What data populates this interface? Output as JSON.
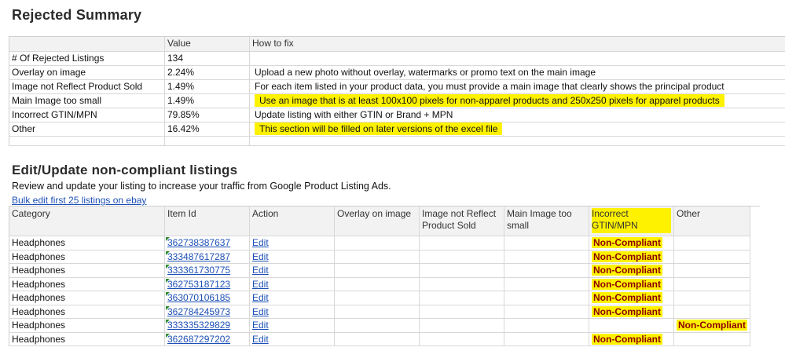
{
  "summary": {
    "title": "Rejected Summary",
    "headers": {
      "label": "",
      "value": "Value",
      "fix": "How to fix"
    },
    "rows": [
      {
        "label": "# Of Rejected Listings",
        "value": "134",
        "fix": ""
      },
      {
        "label": "Overlay on image",
        "value": "2.24%",
        "fix": "Upload a new photo without overlay, watermarks or promo text on the main image"
      },
      {
        "label": "Image not Reflect Product Sold",
        "value": "1.49%",
        "fix": "For each item listed in your product data, you must provide a main image that clearly shows the principal product"
      },
      {
        "label": "Main Image too small",
        "value": "1.49%",
        "fix": "Use an image that is at least 100x100 pixels for non-apparel products and 250x250 pixels for apparel products"
      },
      {
        "label": "Incorrect GTIN/MPN",
        "value": "79.85%",
        "fix": "Update listing with either GTIN or Brand + MPN"
      },
      {
        "label": "Other",
        "value": "16.42%",
        "fix": "This section will be filled on later versions of the excel file"
      }
    ]
  },
  "listings": {
    "title": "Edit/Update non-compliant listings",
    "subtitle": "Review and update your listing to increase your traffic from Google Product Listing Ads.",
    "bulk_link": "Bulk edit first 25 listings on ebay",
    "columns": [
      "Category",
      "Item Id",
      "Action",
      "Overlay on image",
      "Image not Reflect Product Sold",
      "Main Image too small",
      "Incorrect GTIN/MPN",
      "Other"
    ],
    "status_text": "Non-Compliant",
    "action_text": "Edit",
    "rows": [
      {
        "category": "Headphones",
        "item_id": "362738387637",
        "gtin": "Non-Compliant",
        "other": ""
      },
      {
        "category": "Headphones",
        "item_id": "333487617287",
        "gtin": "Non-Compliant",
        "other": ""
      },
      {
        "category": "Headphones",
        "item_id": "333361730775",
        "gtin": "Non-Compliant",
        "other": ""
      },
      {
        "category": "Headphones",
        "item_id": "362753187123",
        "gtin": "Non-Compliant",
        "other": ""
      },
      {
        "category": "Headphones",
        "item_id": "363070106185",
        "gtin": "Non-Compliant",
        "other": ""
      },
      {
        "category": "Headphones",
        "item_id": "362784245973",
        "gtin": "Non-Compliant",
        "other": ""
      },
      {
        "category": "Headphones",
        "item_id": "333335329829",
        "gtin": "",
        "other": "Non-Compliant"
      },
      {
        "category": "Headphones",
        "item_id": "362687297202",
        "gtin": "Non-Compliant",
        "other": ""
      }
    ]
  },
  "colors": {
    "highlight": "#fff200",
    "status": "#8b0000",
    "link": "#1b4fb5"
  }
}
